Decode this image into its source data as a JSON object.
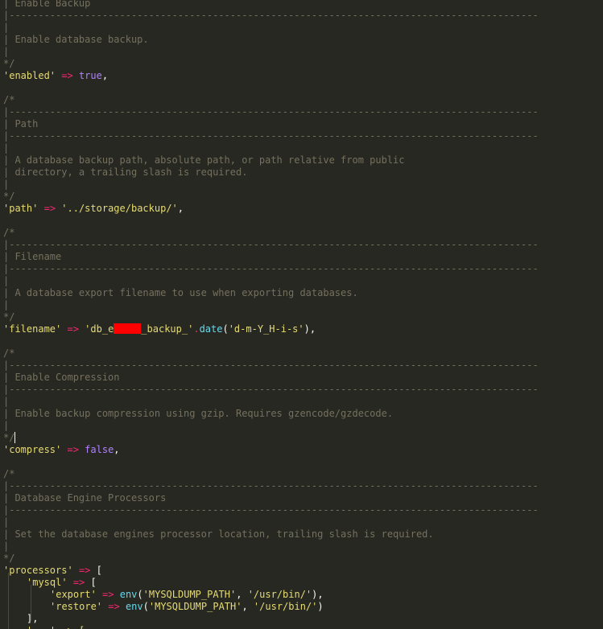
{
  "editor": {
    "sections": [
      {
        "title": "Enable Backup",
        "description": [
          "Enable database backup."
        ],
        "key": "'enabled'",
        "arrow": "=>",
        "value": "true",
        "end": ","
      },
      {
        "title": "Path",
        "description": [
          "A database backup path, absolute path, or path relative from public",
          "directory, a trailing slash is required."
        ],
        "key": "'path'",
        "arrow": "=>",
        "value": "'../storage/backup/'",
        "end": ","
      },
      {
        "title": "Filename",
        "description": [
          "A database export filename to use when exporting databases."
        ],
        "key": "'filename'",
        "arrow": "=>",
        "value_prefix": "'db_",
        "value_visible_char": "e",
        "value_suffix": "_backup_'",
        "concat": ".",
        "func": "date",
        "paren_open": "(",
        "arg": "'d-m-Y_H-i-s'",
        "paren_close": ")",
        "end": ","
      },
      {
        "title": "Enable Compression",
        "description": [
          "Enable backup compression using gzip. Requires gzencode/gzdecode."
        ],
        "key": "'compress'",
        "arrow": "=>",
        "value": "false",
        "end": ","
      },
      {
        "title": "Database Engine Processors",
        "description": [
          "Set the database engines processor location, trailing slash is required."
        ],
        "key": "'processors'",
        "arrow": "=>",
        "value": "["
      }
    ],
    "comment": {
      "open": "/*",
      "close": "*/",
      "bar": "|",
      "rule": "|-------------------------------------------------------------------------------------------"
    },
    "processors": {
      "mysql_key": "'mysql'",
      "arrow": "=>",
      "bracket_open": "[",
      "bracket_close_line": "],",
      "entries": [
        {
          "key": "'export'",
          "arrow": "=>",
          "func": "env",
          "paren_open": "(",
          "arg1": "'MYSQLDUMP_PATH'",
          "comma": ", ",
          "arg2": "'/usr/bin/'",
          "paren_close": "),"
        },
        {
          "key": "'restore'",
          "arrow": "=>",
          "func": "env",
          "paren_open": "(",
          "arg1": "'MYSQLDUMP_PATH'",
          "comma": ", ",
          "arg2": "'/usr/bin/'",
          "paren_close": ")"
        }
      ],
      "partial_line": "'...' => ["
    },
    "colors": {
      "background": "#272822",
      "comment": "#75715e",
      "string": "#e6db74",
      "operator": "#f92672",
      "constant": "#ae81ff",
      "function": "#66d9ef",
      "plain": "#f8f8f2",
      "redaction": "#ff0000"
    }
  }
}
